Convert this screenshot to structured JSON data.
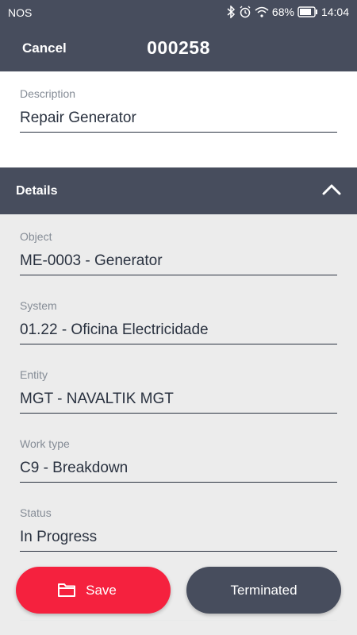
{
  "status_bar": {
    "carrier": "NOS",
    "battery": "68%",
    "time": "14:04"
  },
  "header": {
    "cancel_label": "Cancel",
    "title": "000258"
  },
  "description": {
    "label": "Description",
    "value": "Repair Generator"
  },
  "details": {
    "label": "Details",
    "fields": [
      {
        "label": "Object",
        "value": "ME-0003 - Generator"
      },
      {
        "label": "System",
        "value": "01.22 - Oficina Electricidade"
      },
      {
        "label": "Entity",
        "value": "MGT - NAVALTIK MGT"
      },
      {
        "label": "Work type",
        "value": "C9 - Breakdown"
      },
      {
        "label": "Status",
        "value": "In Progress"
      }
    ]
  },
  "actions": {
    "save_label": "Save",
    "terminated_label": "Terminated"
  },
  "colors": {
    "header": "#474d5d",
    "save": "#f5213e",
    "text": "#2a3240",
    "label": "#858c96"
  },
  "icons": {
    "collapse": "chevron-up-icon",
    "save": "folder-icon"
  }
}
